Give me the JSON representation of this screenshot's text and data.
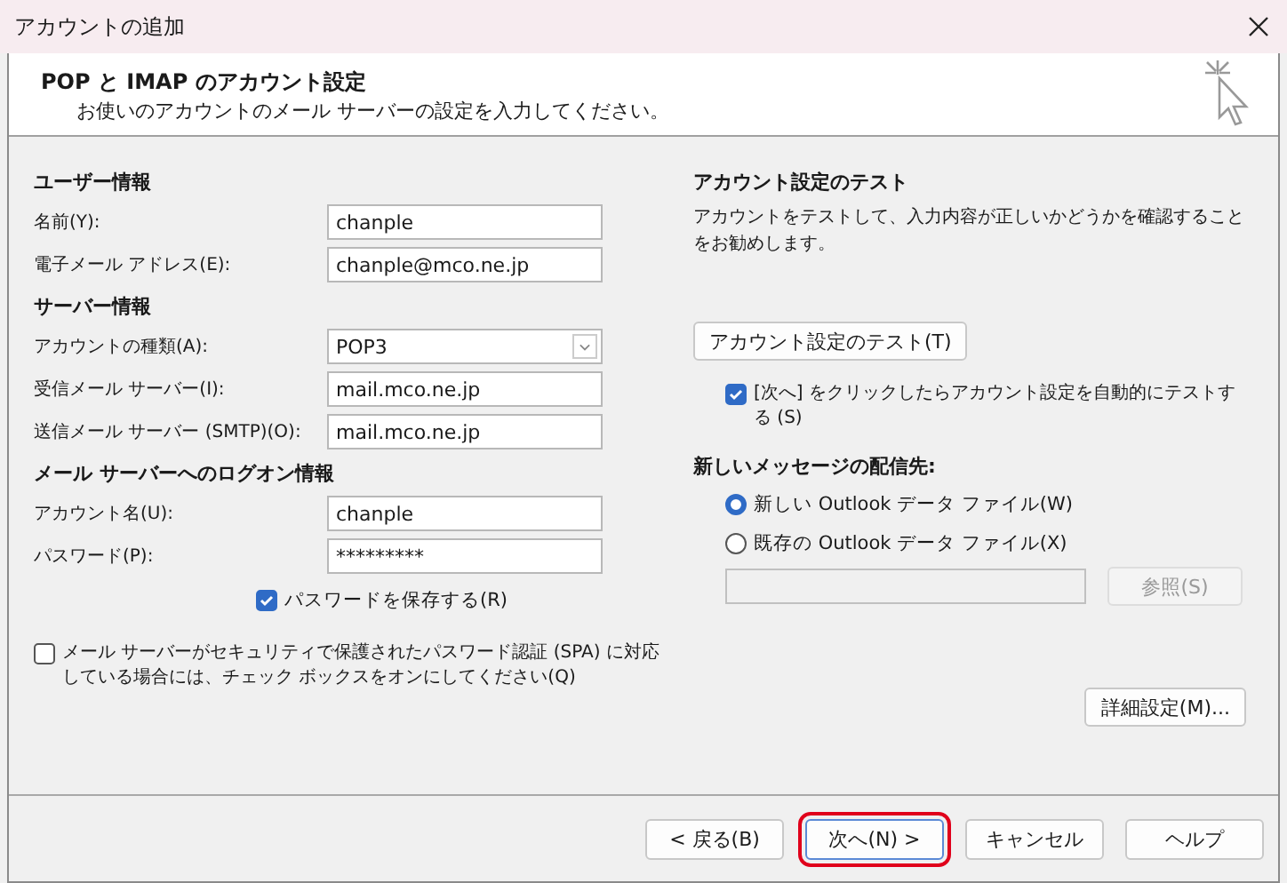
{
  "window": {
    "title": "アカウントの追加"
  },
  "header": {
    "title": "POP と IMAP のアカウント設定",
    "subtitle": "お使いのアカウントのメール サーバーの設定を入力してください。"
  },
  "sections": [
    {
      "heading": "ユーザー情報",
      "fields": [
        {
          "kind": "text",
          "label": "名前(Y):",
          "value": "chanple"
        },
        {
          "kind": "text",
          "label": "電子メール アドレス(E):",
          "value": "chanple@mco.ne.jp"
        }
      ]
    },
    {
      "heading": "サーバー情報",
      "fields": [
        {
          "kind": "select",
          "label": "アカウントの種類(A):",
          "value": "POP3"
        },
        {
          "kind": "text",
          "label": "受信メール サーバー(I):",
          "value": "mail.mco.ne.jp"
        },
        {
          "kind": "text",
          "label": "送信メール サーバー (SMTP)(O):",
          "value": "mail.mco.ne.jp"
        }
      ]
    },
    {
      "heading": "メール サーバーへのログオン情報",
      "fields": [
        {
          "kind": "text",
          "label": "アカウント名(U):",
          "value": "chanple"
        },
        {
          "kind": "password",
          "label": "パスワード(P):",
          "value": "*********"
        }
      ]
    }
  ],
  "save_password": {
    "label": "パスワードを保存する(R)",
    "checked": true
  },
  "spa": {
    "label": "メール サーバーがセキュリティで保護されたパスワード認証 (SPA) に対応している場合には、チェック ボックスをオンにしてください(Q)",
    "checked": false
  },
  "test": {
    "heading": "アカウント設定のテスト",
    "description": "アカウントをテストして、入力内容が正しいかどうかを確認することをお勧めします。",
    "button": "アカウント設定のテスト(T)",
    "auto_test": {
      "label": "[次へ] をクリックしたらアカウント設定を自動的にテストする (S)",
      "checked": true
    }
  },
  "delivery": {
    "heading": "新しいメッセージの配信先:",
    "options": [
      {
        "label": "新しい Outlook データ ファイル(W)",
        "selected": true
      },
      {
        "label": "既存の Outlook データ ファイル(X)",
        "selected": false
      }
    ],
    "browse_button": {
      "label": "参照(S)",
      "disabled": true
    }
  },
  "advanced_button": "詳細設定(M)...",
  "buttons": [
    {
      "label": "< 戻る(B)",
      "highlighted": false
    },
    {
      "label": "次へ(N) >",
      "highlighted": true
    },
    {
      "label": "キャンセル",
      "highlighted": false
    },
    {
      "label": "ヘルプ",
      "highlighted": false
    }
  ]
}
